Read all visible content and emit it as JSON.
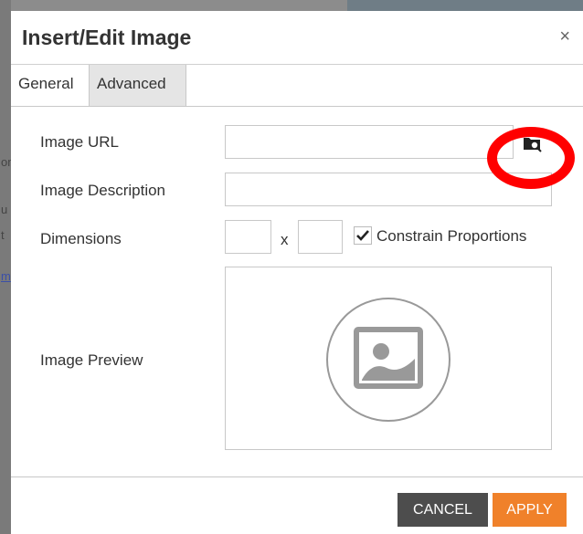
{
  "dialog": {
    "title": "Insert/Edit Image",
    "close_glyph": "×"
  },
  "tabs": [
    {
      "label": "General",
      "active": true
    },
    {
      "label": "Advanced",
      "active": false
    }
  ],
  "form": {
    "image_url": {
      "label": "Image URL",
      "value": ""
    },
    "image_description": {
      "label": "Image Description",
      "value": ""
    },
    "dimensions": {
      "label": "Dimensions",
      "width": "",
      "height": "",
      "separator": "x"
    },
    "constrain": {
      "label": "Constrain Proportions",
      "checked": true
    },
    "preview": {
      "label": "Image Preview"
    }
  },
  "icons": {
    "browse": "folder-search-icon",
    "placeholder": "image-placeholder-icon",
    "checkmark": "checkmark-icon"
  },
  "footer": {
    "cancel_label": "CANCEL",
    "apply_label": "APPLY"
  },
  "background_fragments": [
    "om",
    "u",
    "t",
    "m"
  ],
  "colors": {
    "apply": "#f0812a",
    "cancel": "#4d4d4d",
    "annotation": "#ff0000"
  }
}
